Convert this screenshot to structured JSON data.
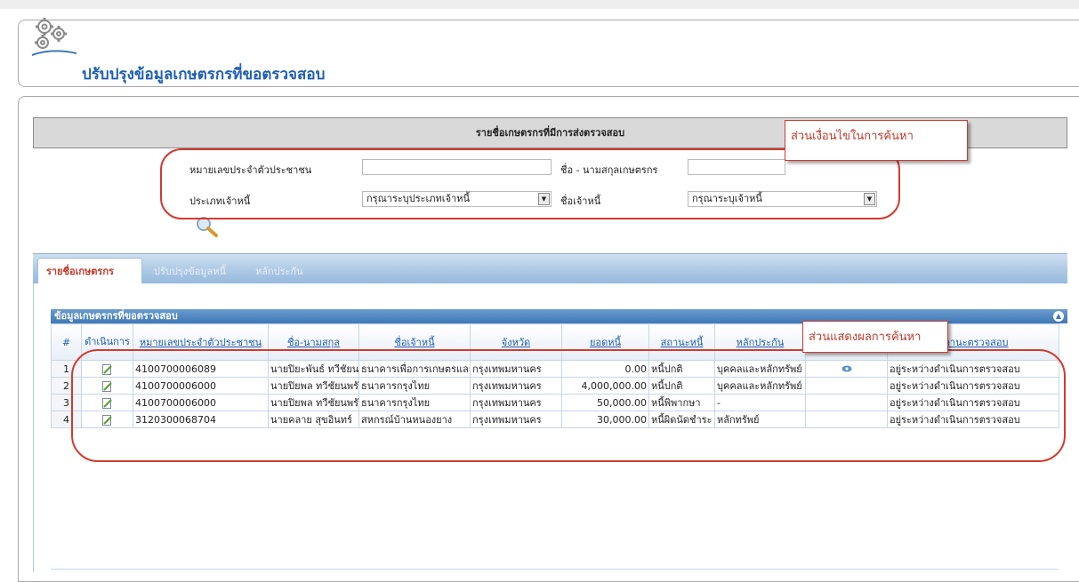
{
  "page": {
    "title": "ปรับปรุงข้อมูลเกษตรกรที่ขอตรวจสอบ",
    "icon": "gears-icon"
  },
  "search": {
    "header": "รายชื่อเกษตรกรที่มีการส่งตรวจสอบ",
    "id_label": "หมายเลขประจำตัวประชาชน",
    "id_value": "",
    "name_label": "ชื่อ - นามสกุลเกษตรกร",
    "name_value": "",
    "creditor_type_label": "ประเภทเจ้าหนี้",
    "creditor_type_value": "กรุณาระบุประเภทเจ้าหนี้",
    "creditor_name_label": "ชื่อเจ้าหนี้",
    "creditor_name_value": "กรุณาระบุเจ้าหนี้",
    "search_icon": "magnifier-icon"
  },
  "annotations": {
    "search_callout": "ส่วนเงื่อนไขในการค้นหา",
    "result_callout": "ส่วนแสดงผลการค้นหา",
    "color": "#d23a2f"
  },
  "tabs": [
    {
      "label": "รายชื่อเกษตรกร",
      "active": true
    },
    {
      "label": "ปรับปรุงข้อมูลหนี้",
      "active": false
    },
    {
      "label": "หลักประกัน",
      "active": false
    }
  ],
  "grid": {
    "title": "ข้อมูลเกษตรกรที่ขอตรวจสอบ",
    "columns": [
      "#",
      "ดำเนินการ",
      "หมายเลขประจำตัวประชาชน",
      "ชื่อ-นามสกุล",
      "ชื่อเจ้าหนี้",
      "จังหวัด",
      "ยอดหนี้",
      "สถานะหนี้",
      "หลักประกัน",
      "",
      "สถานะตรวจสอบ"
    ],
    "rows": [
      {
        "no": "1",
        "id": "4100700006089",
        "name": "นายปิยะพันธ์ ทวีชัยนพรัต",
        "creditor": "ธนาคารเพื่อการเกษตรและสหกรณ์การเกษตร",
        "province": "กรุงเทพมหานคร",
        "amount": "0.00",
        "debt_status": "หนี้ปกติ",
        "collateral": "บุคคลและหลักทรัพย์",
        "view": "eye-icon",
        "check_status": "อยู่ระหว่างดำเนินการตรวจสอบ"
      },
      {
        "no": "2",
        "id": "4100700006000",
        "name": "นายปิยพล ทวีชัยนพรัตน์",
        "creditor": "ธนาคารกรุงไทย",
        "province": "กรุงเทพมหานคร",
        "amount": "4,000,000.00",
        "debt_status": "หนี้ปกติ",
        "collateral": "บุคคลและหลักทรัพย์",
        "view": "",
        "check_status": "อยู่ระหว่างดำเนินการตรวจสอบ"
      },
      {
        "no": "3",
        "id": "4100700006000",
        "name": "นายปิยพล ทวีชัยนพรัตน์",
        "creditor": "ธนาคารกรุงไทย",
        "province": "กรุงเทพมหานคร",
        "amount": "50,000.00",
        "debt_status": "หนี้พิพากษา",
        "collateral": "-",
        "view": "",
        "check_status": "อยู่ระหว่างดำเนินการตรวจสอบ"
      },
      {
        "no": "4",
        "id": "3120300068704",
        "name": "นายคลาย สุขอินทร์",
        "creditor": "สหกรณ์บ้านหนองยาง",
        "province": "กรุงเทพมหานคร",
        "amount": "30,000.00",
        "debt_status": "หนี้ผิดนัดชำระ",
        "collateral": "หลักทรัพย์",
        "view": "",
        "check_status": "อยู่ระหว่างดำเนินการตรวจสอบ"
      }
    ]
  }
}
